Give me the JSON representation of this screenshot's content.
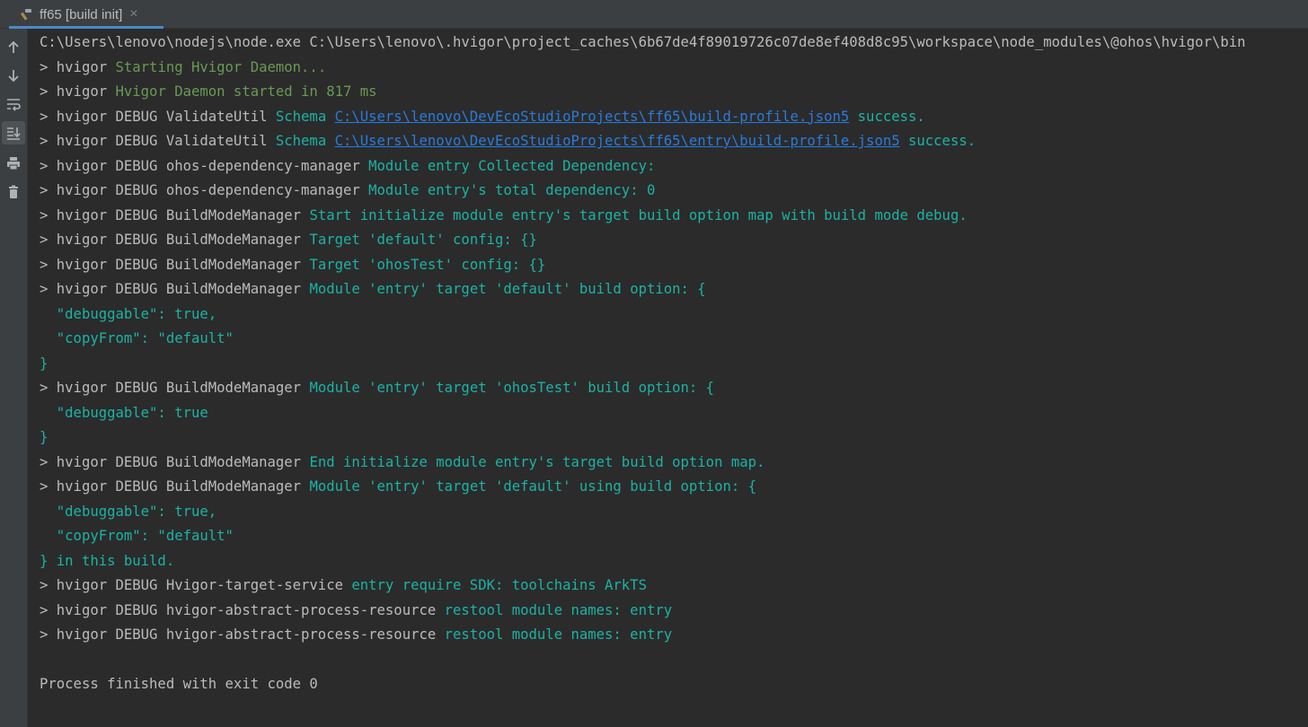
{
  "tab": {
    "title": "ff65 [build init]",
    "icon": "hammer-icon",
    "close": "×"
  },
  "sidebar": {
    "buttons": [
      {
        "name": "up-arrow-icon"
      },
      {
        "name": "down-arrow-icon"
      },
      {
        "name": "soft-wrap-icon"
      },
      {
        "name": "scroll-to-end-icon"
      },
      {
        "name": "print-icon"
      },
      {
        "name": "trash-icon"
      }
    ]
  },
  "colors": {
    "background": "#2b2b2b",
    "default_text": "#bbbbbb",
    "green": "#6a9955",
    "cyan": "#1bb3a4",
    "link": "#287bde",
    "accent": "#4a88c7"
  },
  "console": {
    "lines": [
      [
        {
          "t": "C:\\Users\\lenovo\\nodejs\\node.exe C:\\Users\\lenovo\\.hvigor\\project_caches\\6b67de4f89019726c07de8ef408d8c95\\workspace\\node_modules\\@ohos\\hvigor\\bin",
          "c": "default"
        }
      ],
      [
        {
          "t": "> hvigor ",
          "c": "default"
        },
        {
          "t": "Starting Hvigor Daemon...",
          "c": "green"
        }
      ],
      [
        {
          "t": "> hvigor ",
          "c": "default"
        },
        {
          "t": "Hvigor Daemon started in 817 ms",
          "c": "green"
        }
      ],
      [
        {
          "t": "> hvigor DEBUG ValidateUtil ",
          "c": "default"
        },
        {
          "t": "Schema ",
          "c": "cyan"
        },
        {
          "t": "C:\\Users\\lenovo\\DevEcoStudioProjects\\ff65\\build-profile.json5",
          "c": "link"
        },
        {
          "t": " success.",
          "c": "cyan"
        }
      ],
      [
        {
          "t": "> hvigor DEBUG ValidateUtil ",
          "c": "default"
        },
        {
          "t": "Schema ",
          "c": "cyan"
        },
        {
          "t": "C:\\Users\\lenovo\\DevEcoStudioProjects\\ff65\\entry\\build-profile.json5",
          "c": "link"
        },
        {
          "t": " success.",
          "c": "cyan"
        }
      ],
      [
        {
          "t": "> hvigor DEBUG ohos-dependency-manager ",
          "c": "default"
        },
        {
          "t": "Module entry Collected Dependency:",
          "c": "cyan"
        }
      ],
      [
        {
          "t": "> hvigor DEBUG ohos-dependency-manager ",
          "c": "default"
        },
        {
          "t": "Module entry's total dependency: 0",
          "c": "cyan"
        }
      ],
      [
        {
          "t": "> hvigor DEBUG BuildModeManager ",
          "c": "default"
        },
        {
          "t": "Start initialize module entry's target build option map with build mode debug.",
          "c": "cyan"
        }
      ],
      [
        {
          "t": "> hvigor DEBUG BuildModeManager ",
          "c": "default"
        },
        {
          "t": "Target 'default' config: {}",
          "c": "cyan"
        }
      ],
      [
        {
          "t": "> hvigor DEBUG BuildModeManager ",
          "c": "default"
        },
        {
          "t": "Target 'ohosTest' config: {}",
          "c": "cyan"
        }
      ],
      [
        {
          "t": "> hvigor DEBUG BuildModeManager ",
          "c": "default"
        },
        {
          "t": "Module 'entry' target 'default' build option: {",
          "c": "cyan"
        }
      ],
      [
        {
          "t": "  \"debuggable\": true,",
          "c": "cyan"
        }
      ],
      [
        {
          "t": "  \"copyFrom\": \"default\"",
          "c": "cyan"
        }
      ],
      [
        {
          "t": "}",
          "c": "cyan"
        }
      ],
      [
        {
          "t": "> hvigor DEBUG BuildModeManager ",
          "c": "default"
        },
        {
          "t": "Module 'entry' target 'ohosTest' build option: {",
          "c": "cyan"
        }
      ],
      [
        {
          "t": "  \"debuggable\": true",
          "c": "cyan"
        }
      ],
      [
        {
          "t": "}",
          "c": "cyan"
        }
      ],
      [
        {
          "t": "> hvigor DEBUG BuildModeManager ",
          "c": "default"
        },
        {
          "t": "End initialize module entry's target build option map.",
          "c": "cyan"
        }
      ],
      [
        {
          "t": "> hvigor DEBUG BuildModeManager ",
          "c": "default"
        },
        {
          "t": "Module 'entry' target 'default' using build option: {",
          "c": "cyan"
        }
      ],
      [
        {
          "t": "  \"debuggable\": true,",
          "c": "cyan"
        }
      ],
      [
        {
          "t": "  \"copyFrom\": \"default\"",
          "c": "cyan"
        }
      ],
      [
        {
          "t": "} in this build.",
          "c": "cyan"
        }
      ],
      [
        {
          "t": "> hvigor DEBUG Hvigor-target-service ",
          "c": "default"
        },
        {
          "t": "entry require SDK: toolchains ArkTS",
          "c": "cyan"
        }
      ],
      [
        {
          "t": "> hvigor DEBUG hvigor-abstract-process-resource ",
          "c": "default"
        },
        {
          "t": "restool module names: entry",
          "c": "cyan"
        }
      ],
      [
        {
          "t": "> hvigor DEBUG hvigor-abstract-process-resource ",
          "c": "default"
        },
        {
          "t": "restool module names: entry",
          "c": "cyan"
        }
      ],
      [
        {
          "t": "",
          "c": "default"
        }
      ],
      [
        {
          "t": "Process finished with exit code 0",
          "c": "default"
        }
      ]
    ]
  }
}
